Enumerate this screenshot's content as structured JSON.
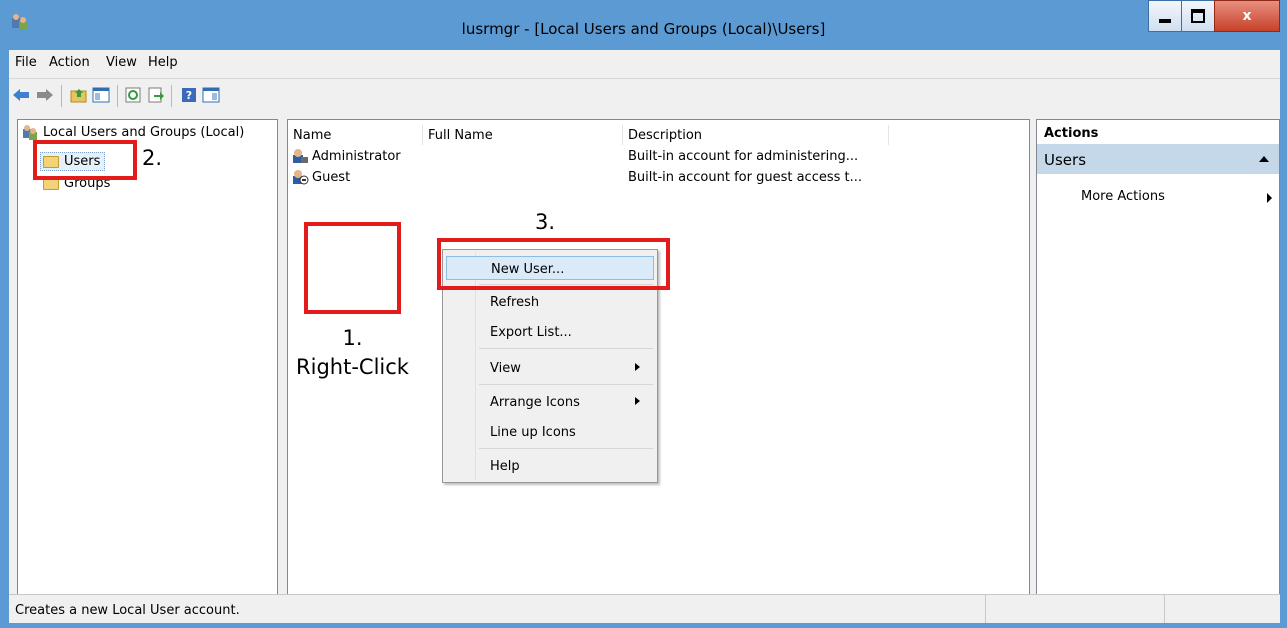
{
  "window": {
    "title": "lusrmgr - [Local Users and Groups (Local)\\Users]",
    "close_glyph": "x"
  },
  "menu": [
    "File",
    "Action",
    "View",
    "Help"
  ],
  "toolbar": {
    "icons": [
      "back-icon",
      "forward-icon",
      "up-folder-icon",
      "show-tree-icon",
      "refresh-icon",
      "export-list-icon",
      "help-icon",
      "show-action-pane-icon"
    ]
  },
  "tree": {
    "root_label": "Local Users and Groups (Local)",
    "items": [
      {
        "label": "Users"
      },
      {
        "label": "Groups"
      }
    ]
  },
  "list": {
    "columns": [
      "Name",
      "Full Name",
      "Description"
    ],
    "rows": [
      {
        "name": "Administrator",
        "full_name": "",
        "description": "Built-in account for administering..."
      },
      {
        "name": "Guest",
        "full_name": "",
        "description": "Built-in account for guest access t..."
      }
    ]
  },
  "context_menu": {
    "items": [
      "New User...",
      "Refresh",
      "Export List...",
      "View",
      "Arrange Icons",
      "Line up Icons",
      "Help"
    ]
  },
  "actions": {
    "header": "Actions",
    "section": "Users",
    "more": "More Actions"
  },
  "status": {
    "text": "Creates a new Local User account."
  },
  "annotations": {
    "step1_num": "1.",
    "step1_text": "Right-Click",
    "step2": "2.",
    "step3": "3."
  },
  "colors": {
    "annotation_red": "#e41b1b",
    "highlight": "#dbeaf9",
    "window_frame": "#5c9ad3"
  }
}
